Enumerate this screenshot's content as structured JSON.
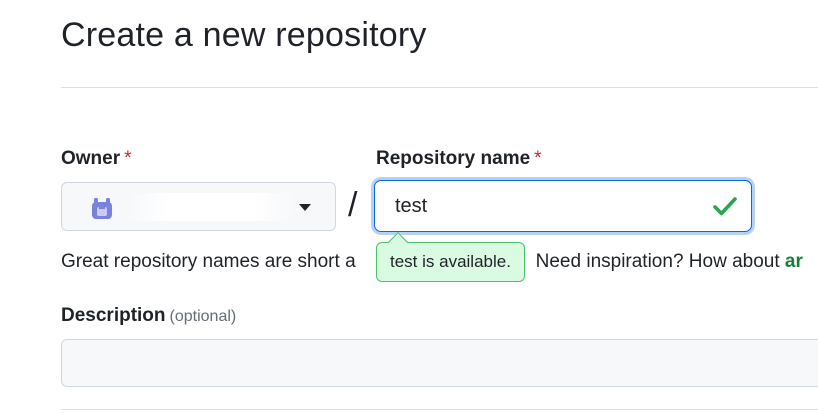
{
  "page": {
    "title": "Create a new repository"
  },
  "owner": {
    "label": "Owner",
    "required_mark": "*",
    "avatar_icon": "octocat-avatar-icon",
    "avatar_color": "#7a82e0"
  },
  "separator": "/",
  "repository": {
    "label": "Repository name",
    "required_mark": "*",
    "value": "test",
    "status_icon": "check-icon",
    "status_color": "#2da44e"
  },
  "availability": {
    "message": "test is available."
  },
  "helper": {
    "text_start": "Great repository names are short a",
    "text_end": "Need inspiration? How about ",
    "link_text": "ar"
  },
  "description": {
    "label": "Description",
    "optional_label": "(optional)",
    "value": ""
  },
  "colors": {
    "accent": "#0969da",
    "success": "#1a7f37",
    "required": "#d1242f"
  }
}
